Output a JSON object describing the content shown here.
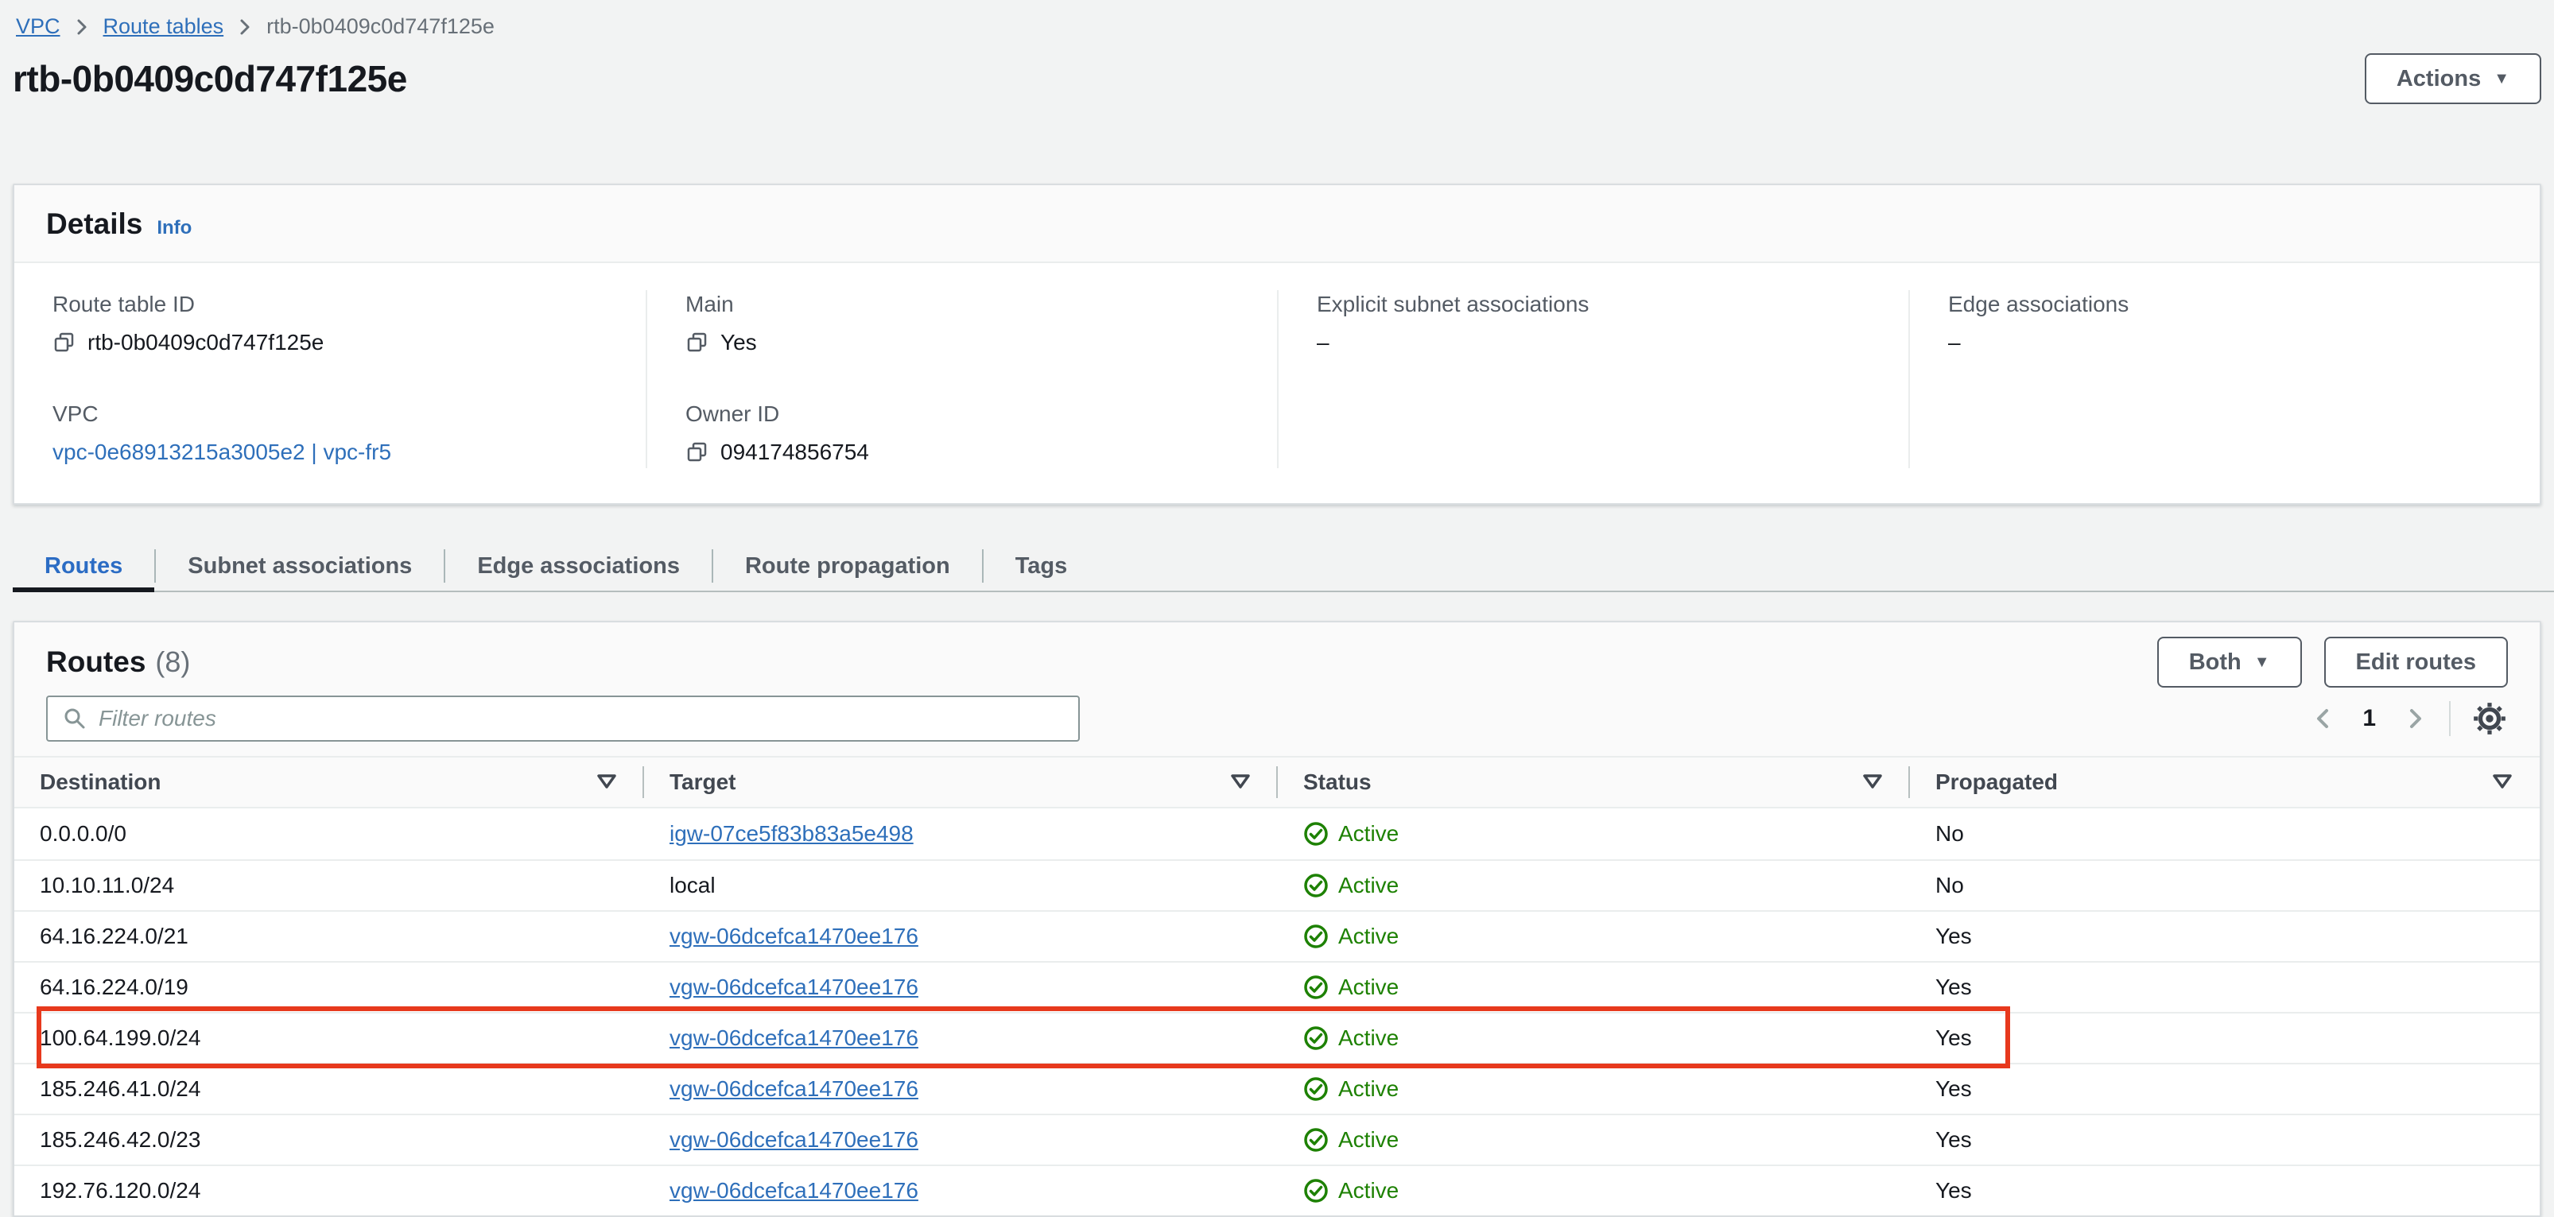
{
  "colors": {
    "page_bg": "#f2f3f3",
    "link_blue": "#2e6fba",
    "active_tab_blue": "#2b6cc4",
    "status_green": "#1d8102",
    "highlight_red": "#e7391d",
    "text_primary": "#16191f",
    "text_secondary": "#545b64"
  },
  "icons": {
    "dropdown_caret": "▼"
  },
  "breadcrumb": {
    "items": [
      {
        "label": "VPC"
      },
      {
        "label": "Route tables"
      },
      {
        "label": "rtb-0b0409c0d747f125e"
      }
    ]
  },
  "header": {
    "title": "rtb-0b0409c0d747f125e",
    "actions_label": "Actions"
  },
  "details": {
    "title": "Details",
    "info_label": "Info",
    "route_table_id": {
      "label": "Route table ID",
      "value": "rtb-0b0409c0d747f125e"
    },
    "vpc": {
      "label": "VPC",
      "value": "vpc-0e68913215a3005e2 | vpc-fr5"
    },
    "main": {
      "label": "Main",
      "value": "Yes"
    },
    "owner_id": {
      "label": "Owner ID",
      "value": "094174856754"
    },
    "explicit_subnet_associations": {
      "label": "Explicit subnet associations",
      "value": "–"
    },
    "edge_associations": {
      "label": "Edge associations",
      "value": "–"
    }
  },
  "tabs": [
    {
      "label": "Routes",
      "active": true
    },
    {
      "label": "Subnet associations",
      "active": false
    },
    {
      "label": "Edge associations",
      "active": false
    },
    {
      "label": "Route propagation",
      "active": false
    },
    {
      "label": "Tags",
      "active": false
    }
  ],
  "routes_panel": {
    "title": "Routes",
    "count": "(8)",
    "filter_placeholder": "Filter routes",
    "controls": {
      "both_label": "Both",
      "edit_label": "Edit routes"
    },
    "pagination": {
      "page": "1"
    },
    "columns": [
      "Destination",
      "Target",
      "Status",
      "Propagated"
    ],
    "rows": [
      {
        "destination": "0.0.0.0/0",
        "target": "igw-07ce5f83b83a5e498",
        "status": "Active",
        "propagated": "No"
      },
      {
        "destination": "10.10.11.0/24",
        "target": "local",
        "status": "Active",
        "propagated": "No"
      },
      {
        "destination": "64.16.224.0/21",
        "target": "vgw-06dcefca1470ee176",
        "status": "Active",
        "propagated": "Yes"
      },
      {
        "destination": "64.16.224.0/19",
        "target": "vgw-06dcefca1470ee176",
        "status": "Active",
        "propagated": "Yes"
      },
      {
        "destination": "100.64.199.0/24",
        "target": "vgw-06dcefca1470ee176",
        "status": "Active",
        "propagated": "Yes",
        "highlighted": true
      },
      {
        "destination": "185.246.41.0/24",
        "target": "vgw-06dcefca1470ee176",
        "status": "Active",
        "propagated": "Yes"
      },
      {
        "destination": "185.246.42.0/23",
        "target": "vgw-06dcefca1470ee176",
        "status": "Active",
        "propagated": "Yes"
      },
      {
        "destination": "192.76.120.0/24",
        "target": "vgw-06dcefca1470ee176",
        "status": "Active",
        "propagated": "Yes"
      }
    ]
  }
}
